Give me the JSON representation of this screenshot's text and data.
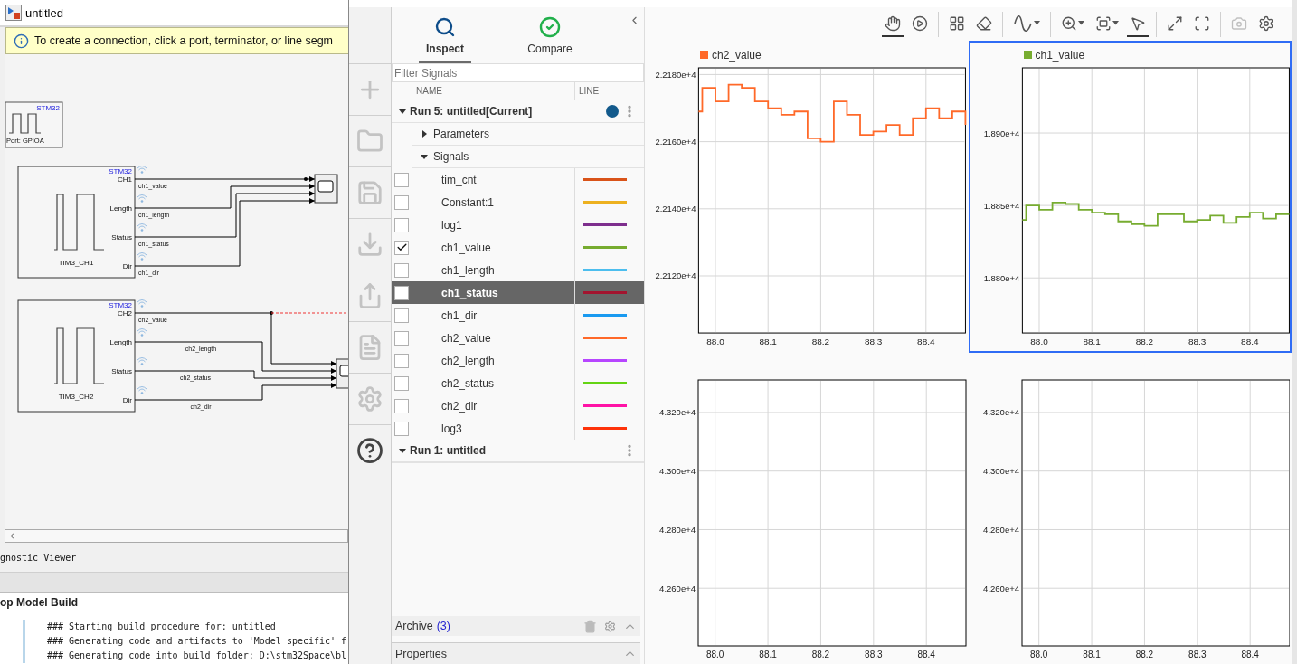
{
  "model": {
    "title": "untitled",
    "info": "To create a connection, click a port, terminator, or line segm",
    "blocks": [
      {
        "kind": "gpio",
        "vendor": "STM32",
        "label": "Port: GPIOA"
      },
      {
        "kind": "timer",
        "vendor": "STM32",
        "name": "TIM3_CH1",
        "ports": [
          {
            "label": "CH1",
            "signal": "ch1_value"
          },
          {
            "label": "Length",
            "signal": "ch1_length"
          },
          {
            "label": "Status",
            "signal": "ch1_status"
          },
          {
            "label": "Dir",
            "signal": "ch1_dir"
          }
        ]
      },
      {
        "kind": "timer",
        "vendor": "STM32",
        "name": "TIM3_CH2",
        "ports": [
          {
            "label": "CH2",
            "signal": "ch2_value"
          },
          {
            "label": "Length",
            "signal": "ch2_length"
          },
          {
            "label": "Status",
            "signal": "ch2_status"
          },
          {
            "label": "Dir",
            "signal": "ch2_dir"
          }
        ]
      }
    ],
    "diagnostics": {
      "title": "gnostic Viewer",
      "heading": "op Model Build",
      "lines": [
        "### Starting build procedure for: untitled",
        "### Generating code and artifacts to 'Model specific' f",
        "### Generating code into build folder: D:\\stm32Space\\bl"
      ]
    }
  },
  "sdi": {
    "sidebar": [
      {
        "kind": "new"
      },
      {
        "kind": "open"
      },
      {
        "kind": "save"
      },
      {
        "kind": "import"
      },
      {
        "kind": "export"
      },
      {
        "kind": "report"
      },
      {
        "kind": "settings"
      },
      {
        "kind": "help"
      }
    ],
    "tabs": [
      {
        "label": "Inspect",
        "kind": "inspect",
        "selected": true
      },
      {
        "label": "Compare",
        "kind": "compare",
        "selected": false
      }
    ],
    "filter": {
      "placeholder": "Filter Signals"
    },
    "columns": [
      "NAME",
      "LINE"
    ],
    "runs": [
      {
        "label": "Run 5: untitled[Current]",
        "expanded": true,
        "current": true,
        "groups": [
          {
            "label": "Parameters",
            "expanded": false
          },
          {
            "label": "Signals",
            "expanded": true,
            "signals": [
              {
                "name": "tim_cnt",
                "checked": false,
                "selected": false,
                "color": "#d95319"
              },
              {
                "name": "Constant:1",
                "checked": false,
                "selected": false,
                "color": "#edb120"
              },
              {
                "name": "log1",
                "checked": false,
                "selected": false,
                "color": "#7e2f8e"
              },
              {
                "name": "ch1_value",
                "checked": true,
                "selected": false,
                "color": "#77ac30"
              },
              {
                "name": "ch1_length",
                "checked": false,
                "selected": false,
                "color": "#4dbeee"
              },
              {
                "name": "ch1_status",
                "checked": false,
                "selected": true,
                "color": "#a2142f"
              },
              {
                "name": "ch1_dir",
                "checked": false,
                "selected": false,
                "color": "#1a9af0"
              },
              {
                "name": "ch2_value",
                "checked": false,
                "selected": false,
                "color": "#ff6929"
              },
              {
                "name": "ch2_length",
                "checked": false,
                "selected": false,
                "color": "#b746ff"
              },
              {
                "name": "ch2_status",
                "checked": false,
                "selected": false,
                "color": "#64d413"
              },
              {
                "name": "ch2_dir",
                "checked": false,
                "selected": false,
                "color": "#ff13a6"
              },
              {
                "name": "log3",
                "checked": false,
                "selected": false,
                "color": "#fe330a"
              }
            ]
          }
        ]
      },
      {
        "label": "Run 1: untitled",
        "expanded": true,
        "current": false
      }
    ],
    "archive": {
      "label": "Archive",
      "count": "(3)"
    },
    "properties": {
      "label": "Properties"
    },
    "toolbar": [
      [
        {
          "kind": "pan",
          "selected": true,
          "menu": false,
          "disabled": false
        },
        {
          "kind": "replay",
          "selected": false,
          "menu": false,
          "disabled": false
        }
      ],
      [
        {
          "kind": "layout",
          "selected": false,
          "menu": false,
          "disabled": false
        },
        {
          "kind": "clear",
          "selected": false,
          "menu": false,
          "disabled": false
        }
      ],
      [
        {
          "kind": "style",
          "selected": false,
          "menu": true,
          "disabled": false
        }
      ],
      [
        {
          "kind": "zoom",
          "selected": false,
          "menu": true,
          "disabled": false
        },
        {
          "kind": "fit",
          "selected": false,
          "menu": true,
          "disabled": false
        },
        {
          "kind": "cursor",
          "selected": true,
          "menu": false,
          "disabled": false
        }
      ],
      [
        {
          "kind": "expand",
          "selected": false,
          "menu": false,
          "disabled": false
        },
        {
          "kind": "fullscreen",
          "selected": false,
          "menu": false,
          "disabled": false
        }
      ],
      [
        {
          "kind": "snapshot",
          "selected": false,
          "menu": false,
          "disabled": true
        },
        {
          "kind": "settings",
          "selected": false,
          "menu": false,
          "disabled": false
        }
      ]
    ],
    "plots": [
      {
        "selected": false,
        "chart_data": {
          "type": "line",
          "xlim": [
            87.968,
            88.475
          ],
          "ylim": [
            22103,
            22182
          ],
          "xticks": [
            {
              "value": 88,
              "label": "88.0"
            },
            {
              "value": 88.1,
              "label": "88.1"
            },
            {
              "value": 88.2,
              "label": "88.2"
            },
            {
              "value": 88.3,
              "label": "88.3"
            },
            {
              "value": 88.4,
              "label": "88.4"
            }
          ],
          "grid": true,
          "yticks": [
            {
              "value": 22180,
              "label": "2.2180e+4"
            },
            {
              "value": 22160,
              "label": "2.2160e+4"
            },
            {
              "value": 22140,
              "label": "2.2140e+4"
            },
            {
              "value": 22120,
              "label": "2.2120e+4"
            }
          ],
          "x": [
            87.968,
            87.975,
            87.975,
            88.0,
            88.0,
            88.025,
            88.025,
            88.05,
            88.05,
            88.075,
            88.075,
            88.1,
            88.1,
            88.125,
            88.125,
            88.15,
            88.15,
            88.175,
            88.175,
            88.2,
            88.2,
            88.225,
            88.225,
            88.25,
            88.25,
            88.275,
            88.275,
            88.3,
            88.3,
            88.325,
            88.325,
            88.35,
            88.35,
            88.375,
            88.375,
            88.4,
            88.4,
            88.425,
            88.425,
            88.45,
            88.45,
            88.475,
            88.475
          ],
          "series": [
            {
              "name": "ch2_value",
              "color": "#ff6929",
              "values": [
                22169,
                22169,
                22176,
                22176,
                22172,
                22172,
                22177,
                22177,
                22176,
                22176,
                22172,
                22172,
                22170,
                22170,
                22168,
                22168,
                22169,
                22169,
                22161,
                22161,
                22160,
                22160,
                22172,
                22172,
                22168,
                22168,
                22162,
                22162,
                22163,
                22163,
                22165,
                22165,
                22162,
                22162,
                22167,
                22167,
                22170,
                22170,
                22167,
                22167,
                22169,
                22169,
                22165
              ]
            }
          ]
        }
      },
      {
        "selected": true,
        "chart_data": {
          "type": "line",
          "xlim": [
            87.968,
            88.475
          ],
          "ylim": [
            18762,
            18945
          ],
          "xticks": [
            {
              "value": 88,
              "label": "88.0"
            },
            {
              "value": 88.1,
              "label": "88.1"
            },
            {
              "value": 88.2,
              "label": "88.2"
            },
            {
              "value": 88.3,
              "label": "88.3"
            },
            {
              "value": 88.4,
              "label": "88.4"
            }
          ],
          "grid": true,
          "yticks": [
            {
              "value": 18900,
              "label": "1.890e+4"
            },
            {
              "value": 18850,
              "label": "1.885e+4"
            },
            {
              "value": 18800,
              "label": "1.880e+4"
            }
          ],
          "x": [
            87.968,
            87.975,
            87.975,
            88.0,
            88.0,
            88.025,
            88.025,
            88.05,
            88.05,
            88.075,
            88.075,
            88.1,
            88.1,
            88.125,
            88.125,
            88.15,
            88.15,
            88.175,
            88.175,
            88.2,
            88.2,
            88.225,
            88.225,
            88.25,
            88.25,
            88.275,
            88.275,
            88.3,
            88.3,
            88.325,
            88.325,
            88.35,
            88.35,
            88.375,
            88.375,
            88.4,
            88.4,
            88.425,
            88.425,
            88.45,
            88.45,
            88.475,
            88.475
          ],
          "series": [
            {
              "name": "ch1_value",
              "color": "#77ac30",
              "values": [
                18840,
                18840,
                18850,
                18850,
                18847,
                18847,
                18852,
                18852,
                18851,
                18851,
                18847,
                18847,
                18845,
                18845,
                18844,
                18844,
                18839,
                18839,
                18837,
                18837,
                18836,
                18836,
                18844,
                18844,
                18844,
                18844,
                18839,
                18839,
                18840,
                18840,
                18843,
                18843,
                18838,
                18838,
                18842,
                18842,
                18845,
                18845,
                18841,
                18841,
                18844,
                18844,
                18844
              ]
            }
          ]
        }
      },
      {
        "selected": false,
        "chart_data": {
          "type": "line",
          "xlim": [
            87.968,
            88.475
          ],
          "ylim": [
            42403,
            43311
          ],
          "xticks": [
            {
              "value": 88,
              "label": "88.0"
            },
            {
              "value": 88.1,
              "label": "88.1"
            },
            {
              "value": 88.2,
              "label": "88.2"
            },
            {
              "value": 88.3,
              "label": "88.3"
            },
            {
              "value": 88.4,
              "label": "88.4"
            }
          ],
          "grid": true,
          "yticks": [
            {
              "value": 43200,
              "label": "4.320e+4"
            },
            {
              "value": 43000,
              "label": "4.300e+4"
            },
            {
              "value": 42800,
              "label": "4.280e+4"
            },
            {
              "value": 42600,
              "label": "4.260e+4"
            }
          ]
        }
      },
      {
        "selected": false,
        "chart_data": {
          "type": "line",
          "xlim": [
            87.968,
            88.475
          ],
          "ylim": [
            42403,
            43311
          ],
          "xticks": [
            {
              "value": 88,
              "label": "88.0"
            },
            {
              "value": 88.1,
              "label": "88.1"
            },
            {
              "value": 88.2,
              "label": "88.2"
            },
            {
              "value": 88.3,
              "label": "88.3"
            },
            {
              "value": 88.4,
              "label": "88.4"
            }
          ],
          "grid": true,
          "yticks": [
            {
              "value": 43200,
              "label": "4.320e+4"
            },
            {
              "value": 43000,
              "label": "4.300e+4"
            },
            {
              "value": 42800,
              "label": "4.280e+4"
            },
            {
              "value": 42600,
              "label": "4.260e+4"
            }
          ]
        }
      }
    ]
  }
}
